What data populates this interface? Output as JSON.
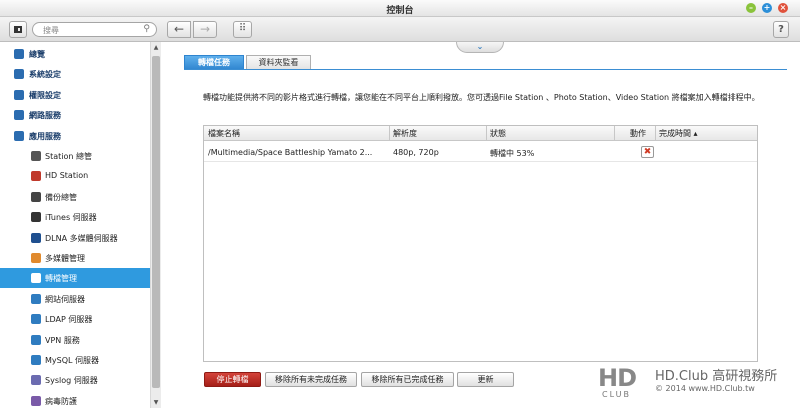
{
  "window": {
    "title": "控制台"
  },
  "toolbar": {
    "search_placeholder": "搜尋",
    "help_label": "?"
  },
  "sidebar": {
    "items": [
      {
        "label": "總覽",
        "level": "top",
        "icon": "overview-icon",
        "color": "#2b6cb0"
      },
      {
        "label": "系統設定",
        "level": "top",
        "icon": "gear-icon",
        "color": "#2b6cb0"
      },
      {
        "label": "權限設定",
        "level": "top",
        "icon": "user-icon",
        "color": "#2b6cb0"
      },
      {
        "label": "網路服務",
        "level": "top",
        "icon": "globe-icon",
        "color": "#2b6cb0"
      },
      {
        "label": "應用服務",
        "level": "top",
        "icon": "apps-icon",
        "color": "#2b6cb0"
      },
      {
        "label": "Station 總管",
        "level": "sub",
        "icon": "station-icon",
        "color": "#555555"
      },
      {
        "label": "HD Station",
        "level": "sub",
        "icon": "hd-station-icon",
        "color": "#c0392b"
      },
      {
        "label": "備份總管",
        "level": "sub",
        "icon": "backup-icon",
        "color": "#444444"
      },
      {
        "label": "iTunes 伺服器",
        "level": "sub",
        "icon": "itunes-icon",
        "color": "#333333"
      },
      {
        "label": "DLNA 多媒體伺服器",
        "level": "sub",
        "icon": "dlna-icon",
        "color": "#1f4f8f"
      },
      {
        "label": "多媒體管理",
        "level": "sub",
        "icon": "media-icon",
        "color": "#e08a2e"
      },
      {
        "label": "轉檔管理",
        "level": "sub",
        "icon": "transcode-icon",
        "color": "#ffffff",
        "active": true
      },
      {
        "label": "網站伺服器",
        "level": "sub",
        "icon": "web-server-icon",
        "color": "#2f7cc0"
      },
      {
        "label": "LDAP 伺服器",
        "level": "sub",
        "icon": "ldap-icon",
        "color": "#2f7cc0"
      },
      {
        "label": "VPN 服務",
        "level": "sub",
        "icon": "vpn-icon",
        "color": "#2f7cc0"
      },
      {
        "label": "MySQL 伺服器",
        "level": "sub",
        "icon": "mysql-icon",
        "color": "#2f7cc0"
      },
      {
        "label": "Syslog 伺服器",
        "level": "sub",
        "icon": "syslog-icon",
        "color": "#6b6bb0"
      },
      {
        "label": "病毒防護",
        "level": "sub",
        "icon": "antivirus-icon",
        "color": "#7a5aa8"
      }
    ]
  },
  "main": {
    "tabs": [
      {
        "label": "轉檔任務",
        "active": true
      },
      {
        "label": "資料夾監看",
        "active": false
      }
    ],
    "description": "轉檔功能提供將不同的影片格式進行轉檔，讓您能在不同平台上順利撥放。您可透過File Station 、Photo Station、Video Station 將檔案加入轉檔排程中。",
    "table": {
      "columns": [
        "檔案名稱",
        "解析度",
        "狀態",
        "動作",
        "完成時間 ▴"
      ],
      "rows": [
        {
          "filename": "/Multimedia/Space Battleship Yamato 2...",
          "resolution": "480p, 720p",
          "status": "轉檔中 53%",
          "action_icon": "delete-icon",
          "completed": ""
        }
      ]
    },
    "buttons": {
      "stop": "停止轉檔",
      "remove_unfinished": "移除所有未完成任務",
      "remove_finished": "移除所有已完成任務",
      "refresh": "更新"
    }
  },
  "watermark": {
    "logo": "HD",
    "club": "CLUB",
    "name": "HD.Club 高研視務所",
    "copyright": "© 2014  www.HD.Club.tw"
  },
  "colors": {
    "accent": "#2f9adf",
    "stop_button": "#b72a22",
    "tab_active": "#3b8ed3"
  }
}
